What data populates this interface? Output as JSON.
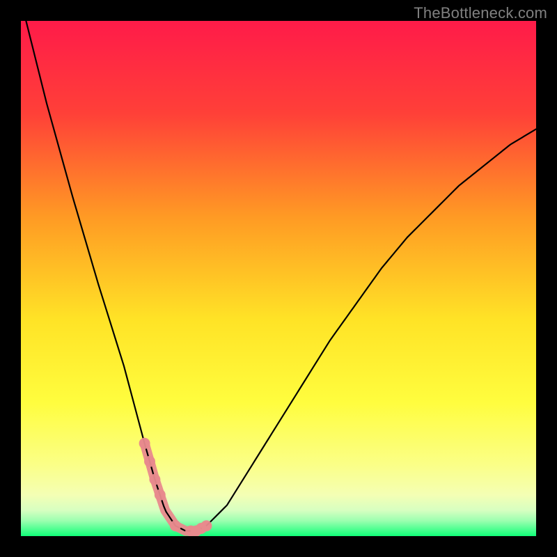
{
  "watermark": "TheBottleneck.com",
  "colors": {
    "background": "#000000",
    "gradient_top": "#ff1b49",
    "gradient_mid_upper": "#ff7a2c",
    "gradient_mid": "#fff128",
    "gradient_lower": "#fbff7a",
    "gradient_band_pale": "#dfffc7",
    "gradient_bottom": "#12ff7a",
    "curve": "#000000",
    "highlight": "#e88a8d"
  },
  "chart_data": {
    "type": "line",
    "title": "",
    "xlabel": "",
    "ylabel": "",
    "xlim": [
      0,
      100
    ],
    "ylim": [
      0,
      100
    ],
    "series": [
      {
        "name": "bottleneck-curve",
        "x": [
          0,
          5,
          10,
          15,
          20,
          24,
          26,
          28,
          30,
          32,
          34,
          36,
          40,
          45,
          50,
          55,
          60,
          65,
          70,
          75,
          80,
          85,
          90,
          95,
          100
        ],
        "y": [
          104,
          84,
          66,
          49,
          33,
          18,
          11,
          5,
          2,
          1,
          1,
          2,
          6,
          14,
          22,
          30,
          38,
          45,
          52,
          58,
          63,
          68,
          72,
          76,
          79
        ]
      }
    ],
    "highlight_region_x": [
      24,
      36
    ],
    "highlight_dots_x": [
      24,
      25,
      26,
      27,
      30,
      33,
      34,
      35,
      36
    ],
    "annotations": []
  }
}
